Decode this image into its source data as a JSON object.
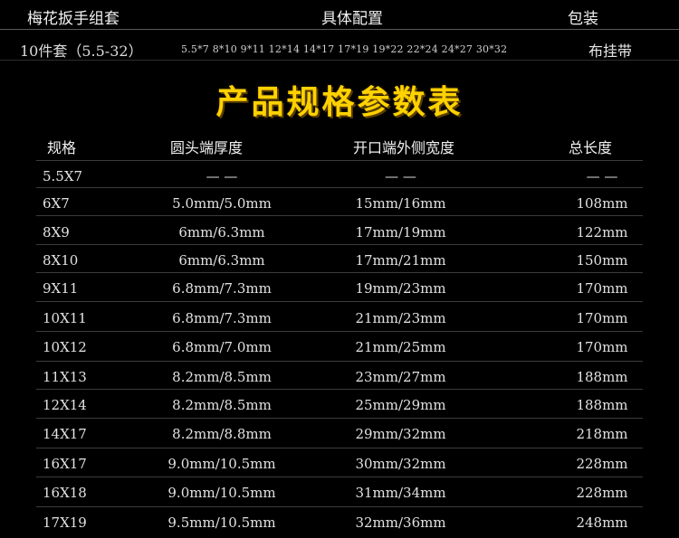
{
  "header": {
    "labels": [
      "梅花扳手组套",
      "具体配置",
      "包装"
    ],
    "set_name": "10件套（5.5-32）",
    "sizes": "5.5*7 8*10 9*11 12*14 14*17 17*19 19*22 22*24 24*27 30*32",
    "package": "布挂带"
  },
  "title": "产品规格参数表",
  "columns": [
    "规格",
    "圆头端厚度",
    "开口端外侧宽度",
    "总长度"
  ],
  "rows": [
    [
      "5.5X7",
      "— —",
      "— —",
      "— —"
    ],
    [
      "6X7",
      "5.0mm/5.0mm",
      "15mm/16mm",
      "108mm"
    ],
    [
      "8X9",
      "6mm/6.3mm",
      "17mm/19mm",
      "122mm"
    ],
    [
      "8X10",
      "6mm/6.3mm",
      "17mm/21mm",
      "150mm"
    ],
    [
      "9X11",
      "6.8mm/7.3mm",
      "19mm/23mm",
      "170mm"
    ],
    [
      "10X11",
      "6.8mm/7.3mm",
      "21mm/23mm",
      "170mm"
    ],
    [
      "10X12",
      "6.8mm/7.0mm",
      "21mm/25mm",
      "170mm"
    ],
    [
      "11X13",
      "8.2mm/8.5mm",
      "23mm/27mm",
      "188mm"
    ],
    [
      "12X14",
      "8.2mm/8.5mm",
      "25mm/29mm",
      "188mm"
    ],
    [
      "14X17",
      "8.2mm/8.8mm",
      "29mm/32mm",
      "218mm"
    ],
    [
      "16X17",
      "9.0mm/10.5mm",
      "30mm/32mm",
      "228mm"
    ],
    [
      "16X18",
      "9.0mm/10.5mm",
      "31mm/34mm",
      "228mm"
    ],
    [
      "17X19",
      "9.5mm/10.5mm",
      "32mm/36mm",
      "248mm"
    ]
  ],
  "colors": {
    "background": "#000000",
    "title": "#ffd200",
    "text": "#e2e2e2"
  }
}
